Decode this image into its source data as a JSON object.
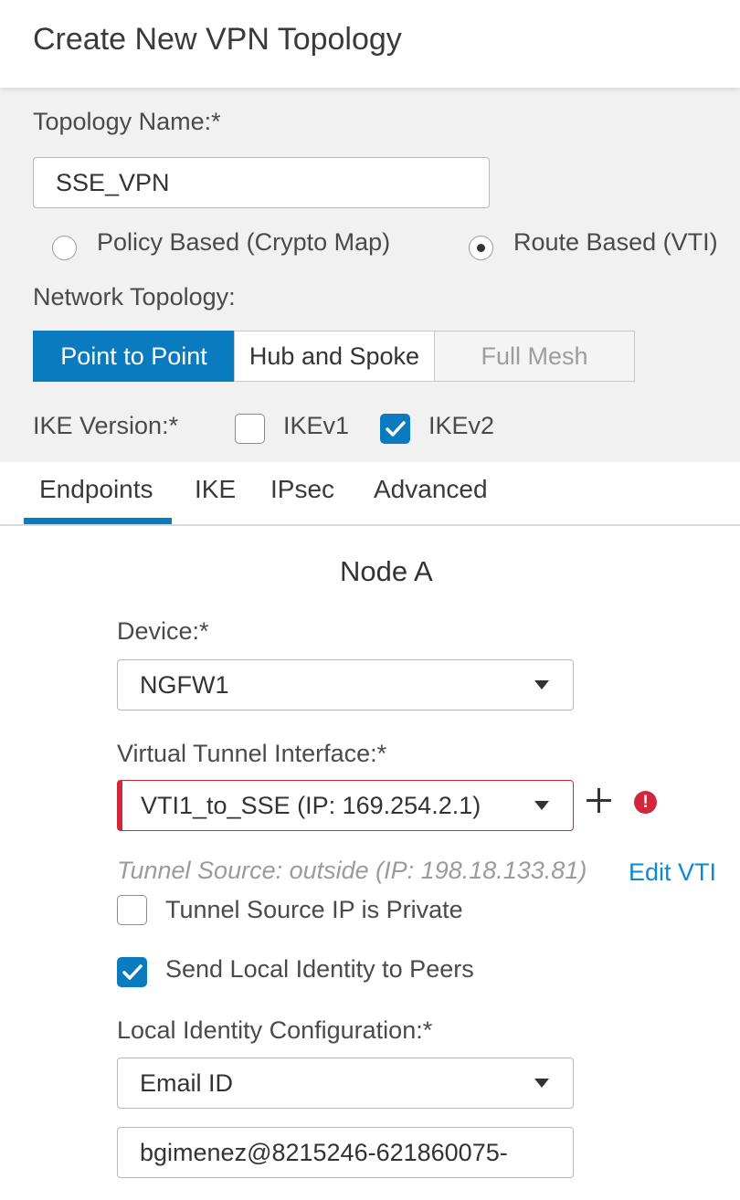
{
  "dialog": {
    "title": "Create New VPN Topology"
  },
  "topology": {
    "name_label": "Topology Name:*",
    "name_value": "SSE_VPN",
    "policy_based_label": "Policy Based (Crypto Map)",
    "route_based_label": "Route Based (VTI)",
    "selected_type": "Route Based (VTI)",
    "network_label": "Network Topology:",
    "network_options": [
      "Point to Point",
      "Hub and Spoke",
      "Full Mesh"
    ],
    "network_selected": "Point to Point",
    "ike_label": "IKE Version:*",
    "ikev1_label": "IKEv1",
    "ikev1_checked": false,
    "ikev2_label": "IKEv2",
    "ikev2_checked": true
  },
  "tabs": [
    "Endpoints",
    "IKE",
    "IPsec",
    "Advanced"
  ],
  "active_tab": "Endpoints",
  "node": {
    "title": "Node A",
    "device_label": "Device:*",
    "device_value": "NGFW1",
    "vti_label": "Virtual Tunnel Interface:*",
    "vti_value": "VTI1_to_SSE (IP: 169.254.2.1)",
    "tunnel_source_hint": "Tunnel Source: outside (IP: 198.18.133.81)",
    "edit_vti_link": "Edit VTI",
    "tunnel_private_label": "Tunnel Source IP is Private",
    "tunnel_private_checked": false,
    "send_identity_label": "Send Local Identity to Peers",
    "send_identity_checked": true,
    "local_identity_label": "Local Identity Configuration:*",
    "local_identity_value": "Email ID",
    "email_value": "bgimenez@8215246-621860075-"
  },
  "colors": {
    "accent": "#0a7bbf",
    "error": "#d0273b",
    "link": "#0a8ad1",
    "panel": "#f1f1f1"
  },
  "icons": [
    "plus-icon",
    "error-icon",
    "chevron-down-icon",
    "checkmark-icon"
  ]
}
